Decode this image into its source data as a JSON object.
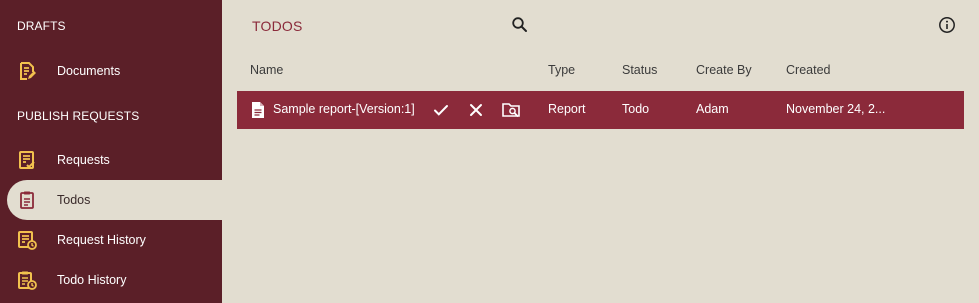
{
  "sidebar": {
    "drafts_title": "DRAFTS",
    "publish_title": "PUBLISH REQUESTS",
    "items": [
      {
        "label": "Documents",
        "icon": "document-edit-icon"
      },
      {
        "label": "Requests",
        "icon": "requests-list-icon"
      },
      {
        "label": "Todos",
        "icon": "clipboard-icon"
      },
      {
        "label": "Request History",
        "icon": "request-history-icon"
      },
      {
        "label": "Todo History",
        "icon": "todo-history-icon"
      }
    ]
  },
  "main": {
    "title": "TODOS",
    "columns": [
      "Name",
      "Type",
      "Status",
      "Create By",
      "Created"
    ],
    "rows": [
      {
        "name": "Sample report-[Version:1]",
        "type": "Report",
        "status": "Todo",
        "created_by": "Adam",
        "created": "November 24, 2..."
      }
    ]
  },
  "colors": {
    "sidebar_bg": "#5b1f28",
    "accent": "#8b2a3a",
    "icon_yellow": "#f2c14e",
    "background": "#e2ddd0"
  }
}
